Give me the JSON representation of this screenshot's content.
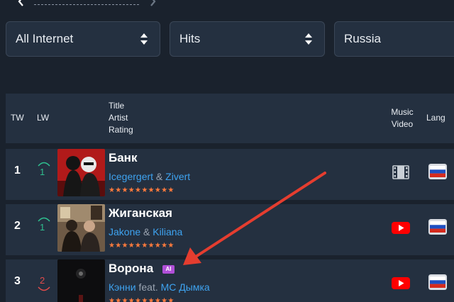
{
  "filters": {
    "source": "All Internet",
    "type": "Hits",
    "country": "Russia"
  },
  "table": {
    "headers": {
      "tw": "TW",
      "lw": "LW",
      "title": "Title",
      "artist": "Artist",
      "rating": "Rating",
      "video": "Music Video",
      "lang": "Lang"
    },
    "rows": [
      {
        "rank": "1",
        "lw": "1",
        "lw_trend": "up",
        "title": "Банк",
        "artist_1": "Icegergert",
        "joiner": " & ",
        "artist_2": "Zivert",
        "stars": "★★★★★★★★★★",
        "video": "film-icon",
        "lang": "ru-flag-icon"
      },
      {
        "rank": "2",
        "lw": "1",
        "lw_trend": "up",
        "title": "Жиганская",
        "artist_1": "Jakone",
        "joiner": " & ",
        "artist_2": "Kiliana",
        "stars": "★★★★★★★★★★",
        "video": "youtube-icon",
        "lang": "ru-flag-icon"
      },
      {
        "rank": "3",
        "lw": "2",
        "lw_trend": "down",
        "title": "Ворона",
        "badge": "AI",
        "artist_1": "Кэнни",
        "joiner": " feat. ",
        "artist_2": "MC Дымка",
        "stars": "★★★★★★★★★★",
        "video": "youtube-icon",
        "lang": "ru-flag-icon"
      }
    ]
  },
  "colors": {
    "background": "#1a222d",
    "panel": "#243040",
    "link": "#3ea3f0",
    "stars": "#ff7a3c",
    "up": "#2fbf8f",
    "down": "#e24b4b",
    "ai_badge": "#b04fd8",
    "annotation": "#e53d2f"
  }
}
